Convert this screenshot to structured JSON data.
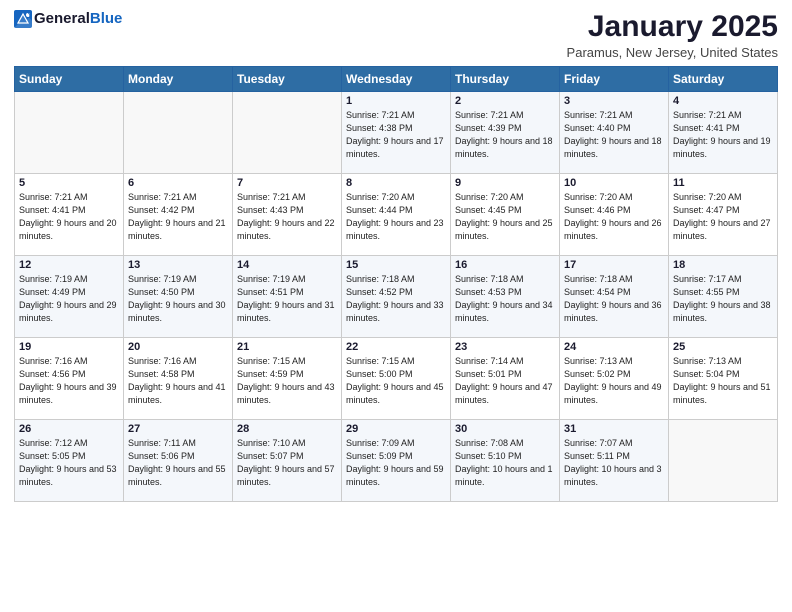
{
  "header": {
    "logo_general": "General",
    "logo_blue": "Blue",
    "month": "January 2025",
    "location": "Paramus, New Jersey, United States"
  },
  "weekdays": [
    "Sunday",
    "Monday",
    "Tuesday",
    "Wednesday",
    "Thursday",
    "Friday",
    "Saturday"
  ],
  "weeks": [
    [
      {
        "day": "",
        "sunrise": "",
        "sunset": "",
        "daylight": ""
      },
      {
        "day": "",
        "sunrise": "",
        "sunset": "",
        "daylight": ""
      },
      {
        "day": "",
        "sunrise": "",
        "sunset": "",
        "daylight": ""
      },
      {
        "day": "1",
        "sunrise": "Sunrise: 7:21 AM",
        "sunset": "Sunset: 4:38 PM",
        "daylight": "Daylight: 9 hours and 17 minutes."
      },
      {
        "day": "2",
        "sunrise": "Sunrise: 7:21 AM",
        "sunset": "Sunset: 4:39 PM",
        "daylight": "Daylight: 9 hours and 18 minutes."
      },
      {
        "day": "3",
        "sunrise": "Sunrise: 7:21 AM",
        "sunset": "Sunset: 4:40 PM",
        "daylight": "Daylight: 9 hours and 18 minutes."
      },
      {
        "day": "4",
        "sunrise": "Sunrise: 7:21 AM",
        "sunset": "Sunset: 4:41 PM",
        "daylight": "Daylight: 9 hours and 19 minutes."
      }
    ],
    [
      {
        "day": "5",
        "sunrise": "Sunrise: 7:21 AM",
        "sunset": "Sunset: 4:41 PM",
        "daylight": "Daylight: 9 hours and 20 minutes."
      },
      {
        "day": "6",
        "sunrise": "Sunrise: 7:21 AM",
        "sunset": "Sunset: 4:42 PM",
        "daylight": "Daylight: 9 hours and 21 minutes."
      },
      {
        "day": "7",
        "sunrise": "Sunrise: 7:21 AM",
        "sunset": "Sunset: 4:43 PM",
        "daylight": "Daylight: 9 hours and 22 minutes."
      },
      {
        "day": "8",
        "sunrise": "Sunrise: 7:20 AM",
        "sunset": "Sunset: 4:44 PM",
        "daylight": "Daylight: 9 hours and 23 minutes."
      },
      {
        "day": "9",
        "sunrise": "Sunrise: 7:20 AM",
        "sunset": "Sunset: 4:45 PM",
        "daylight": "Daylight: 9 hours and 25 minutes."
      },
      {
        "day": "10",
        "sunrise": "Sunrise: 7:20 AM",
        "sunset": "Sunset: 4:46 PM",
        "daylight": "Daylight: 9 hours and 26 minutes."
      },
      {
        "day": "11",
        "sunrise": "Sunrise: 7:20 AM",
        "sunset": "Sunset: 4:47 PM",
        "daylight": "Daylight: 9 hours and 27 minutes."
      }
    ],
    [
      {
        "day": "12",
        "sunrise": "Sunrise: 7:19 AM",
        "sunset": "Sunset: 4:49 PM",
        "daylight": "Daylight: 9 hours and 29 minutes."
      },
      {
        "day": "13",
        "sunrise": "Sunrise: 7:19 AM",
        "sunset": "Sunset: 4:50 PM",
        "daylight": "Daylight: 9 hours and 30 minutes."
      },
      {
        "day": "14",
        "sunrise": "Sunrise: 7:19 AM",
        "sunset": "Sunset: 4:51 PM",
        "daylight": "Daylight: 9 hours and 31 minutes."
      },
      {
        "day": "15",
        "sunrise": "Sunrise: 7:18 AM",
        "sunset": "Sunset: 4:52 PM",
        "daylight": "Daylight: 9 hours and 33 minutes."
      },
      {
        "day": "16",
        "sunrise": "Sunrise: 7:18 AM",
        "sunset": "Sunset: 4:53 PM",
        "daylight": "Daylight: 9 hours and 34 minutes."
      },
      {
        "day": "17",
        "sunrise": "Sunrise: 7:18 AM",
        "sunset": "Sunset: 4:54 PM",
        "daylight": "Daylight: 9 hours and 36 minutes."
      },
      {
        "day": "18",
        "sunrise": "Sunrise: 7:17 AM",
        "sunset": "Sunset: 4:55 PM",
        "daylight": "Daylight: 9 hours and 38 minutes."
      }
    ],
    [
      {
        "day": "19",
        "sunrise": "Sunrise: 7:16 AM",
        "sunset": "Sunset: 4:56 PM",
        "daylight": "Daylight: 9 hours and 39 minutes."
      },
      {
        "day": "20",
        "sunrise": "Sunrise: 7:16 AM",
        "sunset": "Sunset: 4:58 PM",
        "daylight": "Daylight: 9 hours and 41 minutes."
      },
      {
        "day": "21",
        "sunrise": "Sunrise: 7:15 AM",
        "sunset": "Sunset: 4:59 PM",
        "daylight": "Daylight: 9 hours and 43 minutes."
      },
      {
        "day": "22",
        "sunrise": "Sunrise: 7:15 AM",
        "sunset": "Sunset: 5:00 PM",
        "daylight": "Daylight: 9 hours and 45 minutes."
      },
      {
        "day": "23",
        "sunrise": "Sunrise: 7:14 AM",
        "sunset": "Sunset: 5:01 PM",
        "daylight": "Daylight: 9 hours and 47 minutes."
      },
      {
        "day": "24",
        "sunrise": "Sunrise: 7:13 AM",
        "sunset": "Sunset: 5:02 PM",
        "daylight": "Daylight: 9 hours and 49 minutes."
      },
      {
        "day": "25",
        "sunrise": "Sunrise: 7:13 AM",
        "sunset": "Sunset: 5:04 PM",
        "daylight": "Daylight: 9 hours and 51 minutes."
      }
    ],
    [
      {
        "day": "26",
        "sunrise": "Sunrise: 7:12 AM",
        "sunset": "Sunset: 5:05 PM",
        "daylight": "Daylight: 9 hours and 53 minutes."
      },
      {
        "day": "27",
        "sunrise": "Sunrise: 7:11 AM",
        "sunset": "Sunset: 5:06 PM",
        "daylight": "Daylight: 9 hours and 55 minutes."
      },
      {
        "day": "28",
        "sunrise": "Sunrise: 7:10 AM",
        "sunset": "Sunset: 5:07 PM",
        "daylight": "Daylight: 9 hours and 57 minutes."
      },
      {
        "day": "29",
        "sunrise": "Sunrise: 7:09 AM",
        "sunset": "Sunset: 5:09 PM",
        "daylight": "Daylight: 9 hours and 59 minutes."
      },
      {
        "day": "30",
        "sunrise": "Sunrise: 7:08 AM",
        "sunset": "Sunset: 5:10 PM",
        "daylight": "Daylight: 10 hours and 1 minute."
      },
      {
        "day": "31",
        "sunrise": "Sunrise: 7:07 AM",
        "sunset": "Sunset: 5:11 PM",
        "daylight": "Daylight: 10 hours and 3 minutes."
      },
      {
        "day": "",
        "sunrise": "",
        "sunset": "",
        "daylight": ""
      }
    ]
  ]
}
